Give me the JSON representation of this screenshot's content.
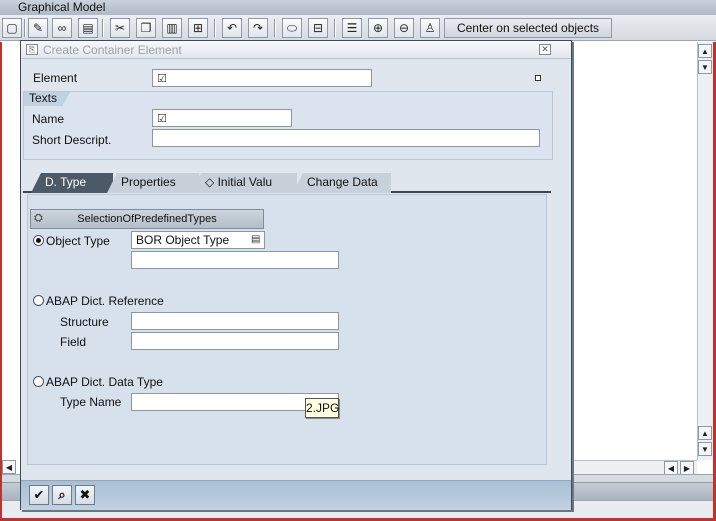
{
  "app": {
    "title": "Graphical Model",
    "toolbar": {
      "icons": [
        "new-document-icon",
        "edit-pencil-icon",
        "glasses-icon",
        "delete-icon",
        "cut-icon",
        "copy-icon",
        "paste-icon",
        "insert-icon",
        "undo-icon",
        "redo-icon",
        "shape-icon",
        "tree-icon",
        "align-icon",
        "zoom-in-icon",
        "zoom-out-icon",
        "person-icon"
      ],
      "center_label": "Center on selected objects"
    }
  },
  "dialog": {
    "title": "Create Container Element",
    "element_label": "Element",
    "element_value": "☑",
    "texts_group": {
      "header": "Texts",
      "name_label": "Name",
      "name_value": "☑",
      "short_desc_label": "Short Descript.",
      "short_desc_value": ""
    },
    "tabs": [
      {
        "label": "D. Type",
        "active": true
      },
      {
        "label": "Properties",
        "active": false
      },
      {
        "label": "◇ Initial Valu",
        "active": false
      },
      {
        "label": "Change Data",
        "active": false
      }
    ],
    "panel": {
      "predefined_button": "SelectionOfPredefinedTypes",
      "object_type": {
        "label": "Object Type",
        "selected": true,
        "type_value": "BOR Object Type",
        "value": ""
      },
      "abap_dict_reference": {
        "label": "ABAP Dict. Reference",
        "selected": false,
        "structure_label": "Structure",
        "structure_value": "",
        "field_label": "Field",
        "field_value": ""
      },
      "abap_dict_data_type": {
        "label": "ABAP Dict. Data Type",
        "selected": false,
        "type_name_label": "Type Name",
        "type_name_value": ""
      }
    },
    "tooltip": "2.JPG",
    "footer_icons": [
      "checkmark-icon",
      "find-icon",
      "cancel-icon"
    ]
  },
  "colors": {
    "dialog_bg": "#dfe6ed",
    "group_bg": "#dbe4ee",
    "active_tab": "#4c5967",
    "footer_bar": "#b2c7da",
    "frame_red": "#c0322e"
  }
}
